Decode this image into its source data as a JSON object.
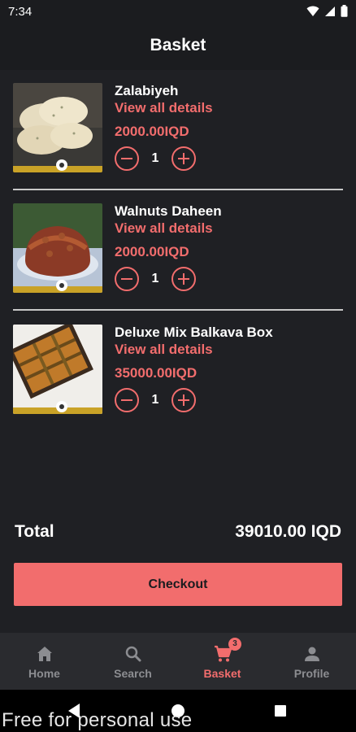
{
  "status_bar": {
    "time": "7:34"
  },
  "header": {
    "title": "Basket"
  },
  "items": [
    {
      "name": "Zalabiyeh",
      "details_link": "View all details",
      "price": "2000.00IQD",
      "quantity": "1",
      "image": "zalabiyeh-photo"
    },
    {
      "name": "Walnuts Daheen",
      "details_link": "View all details",
      "price": "2000.00IQD",
      "quantity": "1",
      "image": "walnuts-daheen-photo"
    },
    {
      "name": "Deluxe Mix Balkava Box",
      "details_link": "View all details",
      "price": "35000.00IQD",
      "quantity": "1",
      "image": "baklava-box-photo"
    }
  ],
  "summary": {
    "total_label": "Total",
    "total_value": "39010.00 IQD"
  },
  "checkout": {
    "label": "Checkout"
  },
  "nav": {
    "items": [
      {
        "label": "Home",
        "icon": "home-icon"
      },
      {
        "label": "Search",
        "icon": "search-icon"
      },
      {
        "label": "Basket",
        "icon": "cart-icon",
        "badge": "3",
        "active": true
      },
      {
        "label": "Profile",
        "icon": "person-icon"
      }
    ]
  },
  "watermark": "Free for personal use",
  "colors": {
    "accent": "#f26d6d",
    "background": "#1f2024",
    "bar": "#1b1c1f",
    "nav_bg": "#2a2b2f",
    "inactive": "#8c8d91"
  }
}
